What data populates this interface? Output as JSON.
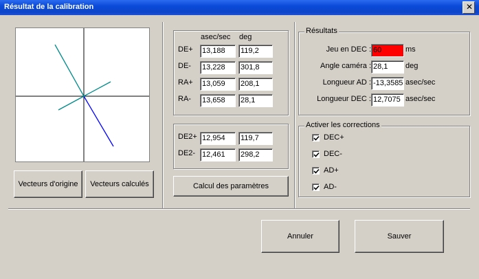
{
  "window": {
    "title": "Résultat de la calibration",
    "close_glyph": "✕"
  },
  "colors": {
    "titlebar": "#0a4ad8",
    "highlight_field": "#ff0000",
    "vector_origin": "#008b8b",
    "vector_calc": "#0000ff"
  },
  "buttons": {
    "vecteurs_origine": "Vecteurs d'origine",
    "vecteurs_calcules": "Vecteurs calculés",
    "calcul_parametres": "Calcul des paramètres",
    "annuler": "Annuler",
    "sauver": "Sauver"
  },
  "measures": {
    "col_asec": "asec/sec",
    "col_deg": "deg",
    "rows": [
      {
        "label": "DE+",
        "asec": "13,188",
        "deg": "119,2"
      },
      {
        "label": "DE-",
        "asec": "13,228",
        "deg": "301,8"
      },
      {
        "label": "RA+",
        "asec": "13,059",
        "deg": "208,1"
      },
      {
        "label": "RA-",
        "asec": "13,658",
        "deg": "28,1"
      }
    ]
  },
  "measures2": {
    "rows": [
      {
        "label": "DE2+",
        "asec": "12,954",
        "deg": "119,7"
      },
      {
        "label": "DE2-",
        "asec": "12,461",
        "deg": "298,2"
      }
    ]
  },
  "results": {
    "legend": "Résultats",
    "jeu_label": "Jeu en DEC :",
    "jeu_value": "60",
    "jeu_unit": "ms",
    "angle_label": "Angle caméra :",
    "angle_value": "28,1",
    "angle_unit": "deg",
    "longad_label": "Longueur AD :",
    "longad_value": "-13,3585",
    "longad_unit": "asec/sec",
    "longdec_label": "Longueur DEC :",
    "longdec_value": "12,7075",
    "longdec_unit": "asec/sec"
  },
  "corrections": {
    "legend": "Activer les corrections",
    "items": [
      {
        "label": "DEC+",
        "checked": true
      },
      {
        "label": "DEC-",
        "checked": true
      },
      {
        "label": "AD+",
        "checked": true
      },
      {
        "label": "AD-",
        "checked": true
      }
    ]
  }
}
